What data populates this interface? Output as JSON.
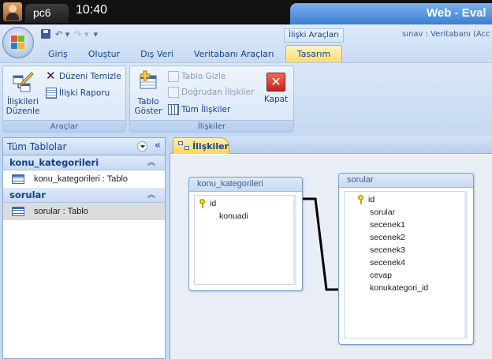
{
  "system": {
    "user_tab": "pc6",
    "clock": "10:40"
  },
  "window": {
    "title": "Web - Eval"
  },
  "ribbon": {
    "context_group": "İlişki Araçları",
    "doc_title": "sınav : Veritabanı (Acc",
    "tabs": [
      "Giriş",
      "Oluştur",
      "Dış Veri",
      "Veritabanı Araçları"
    ],
    "active_tab": "Tasarım",
    "groups": {
      "araclar": {
        "label": "Araçlar",
        "edit_rel_line1": "İlişkileri",
        "edit_rel_line2": "Düzenle",
        "clear_layout": "Düzeni Temizle",
        "rel_report": "İlişki Raporu"
      },
      "iliskiler": {
        "label": "İlişkiler",
        "show_table_line1": "Tablo",
        "show_table_line2": "Göster",
        "hide_table": "Tablo Gizle",
        "direct_rels": "Doğrudan İlişkiler",
        "all_rels": "Tüm İlişkiler",
        "close": "Kapat"
      }
    }
  },
  "nav": {
    "header": "Tüm Tablolar",
    "groups": [
      {
        "name": "konu_kategorileri",
        "item": "konu_kategorileri : Tablo"
      },
      {
        "name": "sorular",
        "item": "sorular : Tablo"
      }
    ]
  },
  "document": {
    "tab": "İlişkiler",
    "tables": [
      {
        "name": "konu_kategorileri",
        "fields": [
          "id",
          "konuadi"
        ]
      },
      {
        "name": "sorular",
        "fields": [
          "id",
          "sorular",
          "secenek1",
          "secenek2",
          "secenek3",
          "secenek4",
          "cevap",
          "konukategori_id"
        ]
      }
    ]
  }
}
